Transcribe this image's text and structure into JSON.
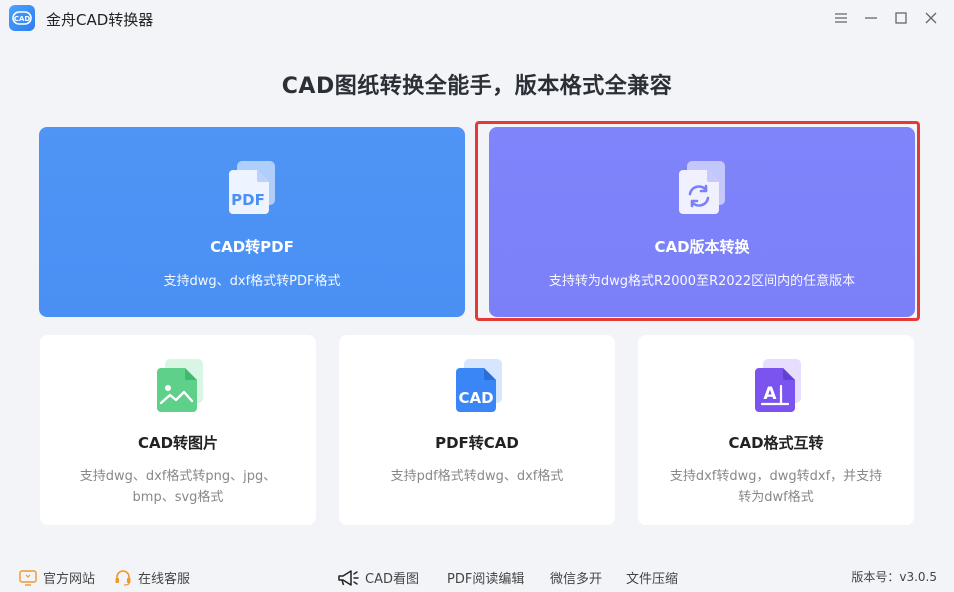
{
  "app": {
    "title": "金舟CAD转换器",
    "logo_text": "CAD"
  },
  "window_controls": [
    "menu-icon",
    "minimize-icon",
    "maximize-icon",
    "close-icon"
  ],
  "headline": "CAD图纸转换全能手，版本格式全兼容",
  "big_cards": [
    {
      "title": "CAD转PDF",
      "desc": "支持dwg、dxf格式转PDF格式",
      "icon": "pdf-file-icon",
      "icon_text": "PDF",
      "color": "#4f95f5"
    },
    {
      "title": "CAD版本转换",
      "desc": "支持转为dwg格式R2000至R2022区间内的任意版本",
      "icon": "version-convert-icon",
      "color": "#7f84fb"
    }
  ],
  "small_cards": [
    {
      "title": "CAD转图片",
      "desc": "支持dwg、dxf格式转png、jpg、bmp、svg格式",
      "icon": "image-file-icon"
    },
    {
      "title": "PDF转CAD",
      "desc": "支持pdf格式转dwg、dxf格式",
      "icon": "cad-file-icon",
      "icon_text": "CAD"
    },
    {
      "title": "CAD格式互转",
      "desc": "支持dxf转dwg，dwg转dxf，并支持转为dwf格式",
      "icon": "format-convert-icon",
      "icon_text": "A"
    }
  ],
  "footer": {
    "website": "官方网站",
    "service": "在线客服",
    "links": [
      "CAD看图",
      "PDF阅读编辑",
      "微信多开",
      "文件压缩"
    ],
    "version": "版本号：v3.0.5"
  }
}
